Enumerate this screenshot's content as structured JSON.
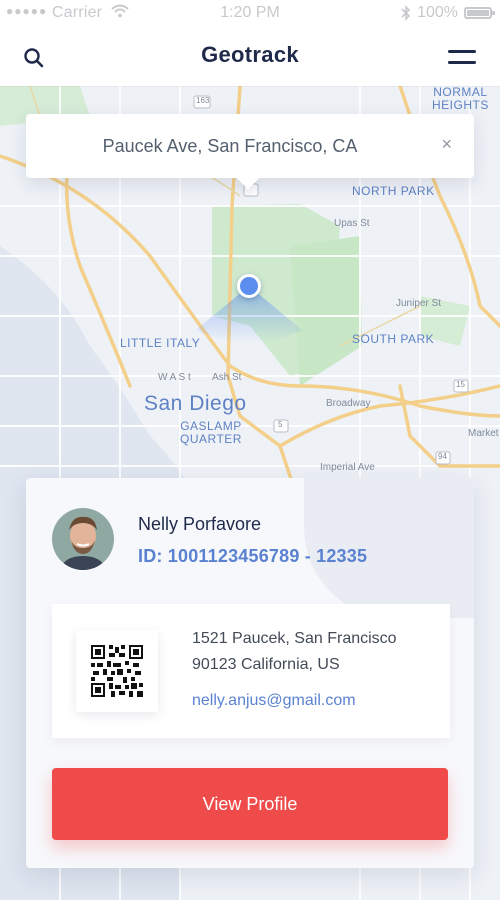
{
  "status_bar": {
    "carrier": "Carrier",
    "time": "1:20 PM",
    "battery": "100%",
    "battery_level": 1.0
  },
  "header": {
    "title": "Geotrack"
  },
  "location_bar": {
    "text": "Paucek Ave, San Francisco, CA",
    "close_glyph": "×"
  },
  "map": {
    "labels": {
      "normal_heights": "NORMAL\nHEIGHTS",
      "north_park": "NORTH PARK",
      "south_park": "SOUTH PARK",
      "little_italy": "LITTLE ITALY",
      "san_diego": "San Diego",
      "gaslamp": "GASLAMP\nQUARTER",
      "upas_st": "Upas St",
      "juniper_st": "Juniper St",
      "broadway": "Broadway",
      "imperial_ave": "Imperial Ave",
      "w_ash": "W A S t",
      "ash_st": "Ash St",
      "market": "Market",
      "route_163": "163",
      "route_15": "15",
      "route_5": "5",
      "route_94": "94"
    }
  },
  "card": {
    "name": "Nelly Porfavore",
    "id": "ID: 1001123456789 - 12335",
    "address_line1": "1521 Paucek, San Francisco",
    "address_line2": "90123 California, US",
    "email": "nelly.anjus@gmail.com",
    "button_label": "View Profile"
  },
  "colors": {
    "accent_blue": "#5b82d1",
    "button_red": "#ef4b4b",
    "title_navy": "#1f2a4a",
    "pin_blue": "#5b8def"
  },
  "icons": {
    "search": "search-icon",
    "menu": "menu-icon",
    "close": "close-icon",
    "wifi": "wifi-icon",
    "bluetooth": "bluetooth-icon",
    "battery": "battery-icon",
    "qr": "qr-code-icon",
    "pin": "location-pin-icon"
  }
}
